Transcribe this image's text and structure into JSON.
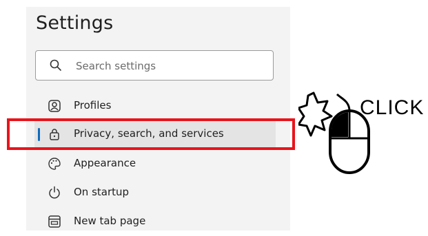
{
  "header": {
    "title": "Settings"
  },
  "search": {
    "placeholder": "Search settings",
    "icon": "search-icon"
  },
  "nav": {
    "items": [
      {
        "label": "Profiles",
        "icon": "profile-icon"
      },
      {
        "label": "Privacy, search, and services",
        "icon": "lock-icon",
        "selected": true
      },
      {
        "label": "Appearance",
        "icon": "palette-icon"
      },
      {
        "label": "On startup",
        "icon": "power-icon"
      },
      {
        "label": "New tab page",
        "icon": "new-tab-page-icon"
      }
    ]
  },
  "annotation": {
    "click_label": "CLICK",
    "highlight_color": "#e8141b"
  },
  "colors": {
    "selected_bar": "#0f6cbd",
    "panel_bg": "#f3f3f3"
  }
}
